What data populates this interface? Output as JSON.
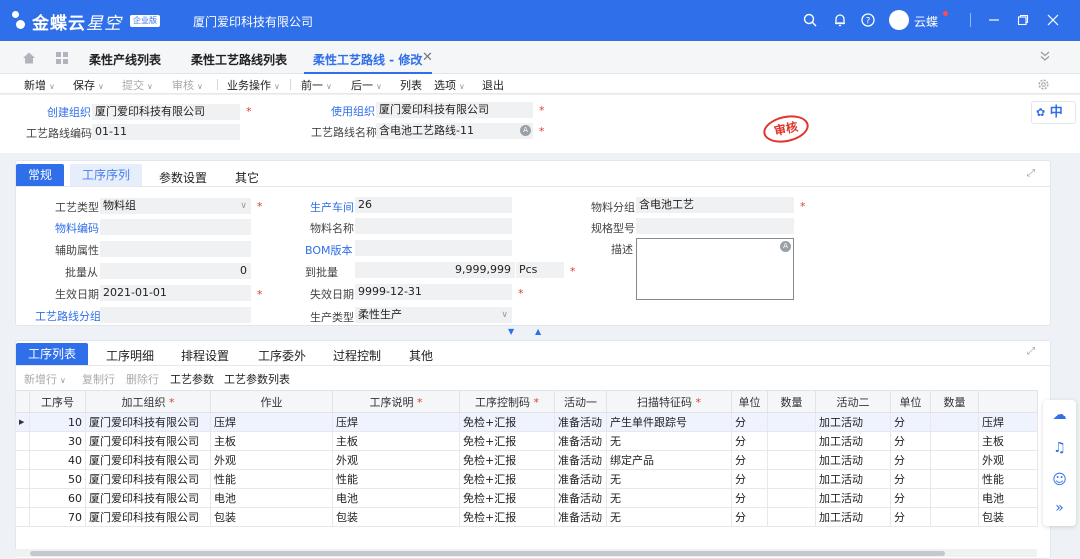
{
  "app": {
    "brand": "金蝶云",
    "brand_product": "星空",
    "badge": "企业版",
    "company": "厦门爱印科技有限公司",
    "username": "云蝶"
  },
  "tabs": [
    {
      "label": "柔性产线列表"
    },
    {
      "label": "柔性工艺路线列表"
    },
    {
      "label": "柔性工艺路线 - 修改"
    }
  ],
  "toolbar": {
    "items": [
      {
        "label": "新增",
        "dropdown": true,
        "disabled": false
      },
      {
        "label": "保存",
        "dropdown": true,
        "disabled": false
      },
      {
        "label": "提交",
        "dropdown": true,
        "disabled": true
      },
      {
        "label": "审核",
        "dropdown": true,
        "disabled": true
      },
      {
        "label": "业务操作",
        "dropdown": true,
        "disabled": false
      },
      {
        "label": "前一",
        "dropdown": true,
        "disabled": false
      },
      {
        "label": "后一",
        "dropdown": true,
        "disabled": false
      },
      {
        "label": "列表",
        "dropdown": false,
        "disabled": false
      },
      {
        "label": "选项",
        "dropdown": true,
        "disabled": false
      },
      {
        "label": "退出",
        "dropdown": false,
        "disabled": false
      }
    ]
  },
  "header": {
    "create_org_label": "创建组织",
    "create_org_value": "厦门爱印科技有限公司",
    "use_org_label": "使用组织",
    "use_org_value": "厦门爱印科技有限公司",
    "route_code_label": "工艺路线编码",
    "route_code_value": "01-11",
    "route_name_label": "工艺路线名称",
    "route_name_value": "含电池工艺路线-11",
    "stamp": "审核",
    "side_tag": "中"
  },
  "panel1": {
    "tabs": [
      "常规",
      "工序序列",
      "参数设置",
      "其它"
    ],
    "fields": {
      "process_type_label": "工艺类型",
      "process_type_value": "物料组",
      "workshop_label": "生产车间",
      "workshop_value": "26",
      "material_group_label": "物料分组",
      "material_group_value": "含电池工艺",
      "material_code_label": "物料编码",
      "material_name_label": "物料名称",
      "spec_label": "规格型号",
      "aux_attr_label": "辅助属性",
      "bom_label": "BOM版本",
      "desc_label": "描述",
      "qty_from_label": "批量从",
      "qty_from_value": "0",
      "qty_to_label": "到批量",
      "qty_to_value": "9,999,999",
      "qty_unit": "Pcs",
      "eff_date_label": "生效日期",
      "eff_date_value": "2021-01-01",
      "exp_date_label": "失效日期",
      "exp_date_value": "9999-12-31",
      "route_group_label": "工艺路线分组",
      "prod_type_label": "生产类型",
      "prod_type_value": "柔性生产"
    }
  },
  "panel2": {
    "tabs": [
      "工序列表",
      "工序明细",
      "排程设置",
      "工序委外",
      "过程控制",
      "其他"
    ],
    "toolbar": [
      {
        "label": "新增行",
        "dropdown": true,
        "disabled": true
      },
      {
        "label": "复制行",
        "dropdown": false,
        "disabled": true
      },
      {
        "label": "删除行",
        "dropdown": false,
        "disabled": true
      },
      {
        "label": "工艺参数",
        "dropdown": false,
        "disabled": false
      },
      {
        "label": "工艺参数列表",
        "dropdown": false,
        "disabled": false
      }
    ],
    "columns": [
      "工序号",
      "加工组织",
      "作业",
      "工序说明",
      "工序控制码",
      "活动一",
      "扫描特征码",
      "单位",
      "数量",
      "活动二",
      "单位",
      "数量",
      ""
    ],
    "required_columns": [
      1,
      3,
      4,
      6
    ],
    "rows": [
      [
        "10",
        "厦门爱印科技有限公司",
        "压焊",
        "压焊",
        "免检+汇报",
        "准备活动",
        "产生单件跟踪号",
        "分",
        "",
        "加工活动",
        "分",
        "",
        "压焊"
      ],
      [
        "30",
        "厦门爱印科技有限公司",
        "主板",
        "主板",
        "免检+汇报",
        "准备活动",
        "无",
        "分",
        "",
        "加工活动",
        "分",
        "",
        "主板"
      ],
      [
        "40",
        "厦门爱印科技有限公司",
        "外观",
        "外观",
        "免检+汇报",
        "准备活动",
        "绑定产品",
        "分",
        "",
        "加工活动",
        "分",
        "",
        "外观"
      ],
      [
        "50",
        "厦门爱印科技有限公司",
        "性能",
        "性能",
        "免检+汇报",
        "准备活动",
        "无",
        "分",
        "",
        "加工活动",
        "分",
        "",
        "性能"
      ],
      [
        "60",
        "厦门爱印科技有限公司",
        "电池",
        "电池",
        "免检+汇报",
        "准备活动",
        "无",
        "分",
        "",
        "加工活动",
        "分",
        "",
        "电池"
      ],
      [
        "70",
        "厦门爱印科技有限公司",
        "包装",
        "包装",
        "免检+汇报",
        "准备活动",
        "无",
        "分",
        "",
        "加工活动",
        "分",
        "",
        "包装"
      ]
    ]
  },
  "colors": {
    "brand_blue": "#2f6fe9",
    "required_red": "#e53935",
    "stamp_red": "#e1342b"
  }
}
